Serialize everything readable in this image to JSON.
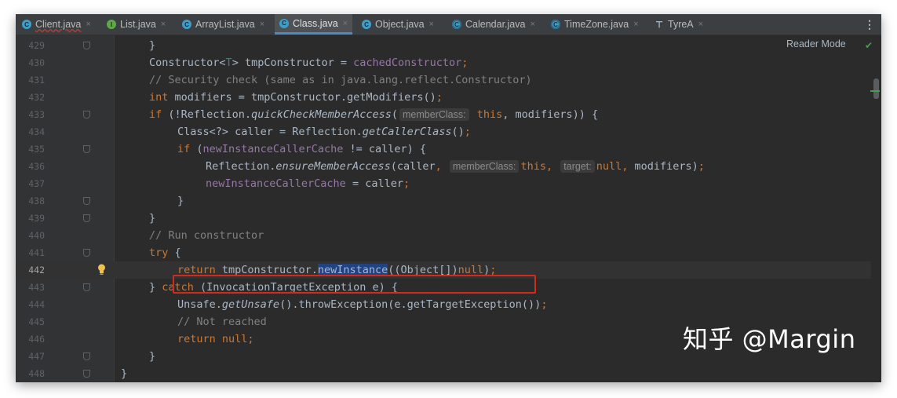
{
  "tabs": [
    {
      "label": "Client.java",
      "icon": "class-icon",
      "active": false
    },
    {
      "label": "List.java",
      "icon": "interface-icon",
      "active": false
    },
    {
      "label": "ArrayList.java",
      "icon": "class-icon",
      "active": false
    },
    {
      "label": "Class.java",
      "icon": "class-icon",
      "active": true
    },
    {
      "label": "Object.java",
      "icon": "class-icon",
      "active": false
    },
    {
      "label": "Calendar.java",
      "icon": "abstract-class-icon",
      "active": false
    },
    {
      "label": "TimeZone.java",
      "icon": "abstract-class-icon",
      "active": false
    },
    {
      "label": "TyreA",
      "icon": "structure-icon",
      "active": false
    }
  ],
  "tab_close_glyph": "×",
  "tab_more_glyph": "⋮",
  "editor": {
    "reader_mode_label": "Reader Mode",
    "current_line": 442,
    "selected_token": "newInstance",
    "colors": {
      "keyword": "#cc7832",
      "field": "#9876aa",
      "comment": "#808080",
      "highlight_box": "#d42a1c",
      "selection": "#214283"
    },
    "lines": [
      {
        "num": "429",
        "text": "}"
      },
      {
        "num": "430",
        "text": "Constructor<T> tmpConstructor = cachedConstructor;"
      },
      {
        "num": "431",
        "text": "// Security check (same as in java.lang.reflect.Constructor)"
      },
      {
        "num": "432",
        "text": "int modifiers = tmpConstructor.getModifiers();"
      },
      {
        "num": "433",
        "text": "if (!Reflection.quickCheckMemberAccess( memberClass: this, modifiers)) {"
      },
      {
        "num": "434",
        "text": "Class<?> caller = Reflection.getCallerClass();"
      },
      {
        "num": "435",
        "text": "if (newInstanceCallerCache != caller) {"
      },
      {
        "num": "436",
        "text": "Reflection.ensureMemberAccess(caller, memberClass: this, target: null, modifiers);"
      },
      {
        "num": "437",
        "text": "newInstanceCallerCache = caller;"
      },
      {
        "num": "438",
        "text": "}"
      },
      {
        "num": "439",
        "text": "}"
      },
      {
        "num": "440",
        "text": "// Run constructor"
      },
      {
        "num": "441",
        "text": "try {"
      },
      {
        "num": "442",
        "text": "return tmpConstructor.newInstance((Object[])null);"
      },
      {
        "num": "443",
        "text": "} catch (InvocationTargetException e) {"
      },
      {
        "num": "444",
        "text": "Unsafe.getUnsafe().throwException(e.getTargetException());"
      },
      {
        "num": "445",
        "text": "// Not reached"
      },
      {
        "num": "446",
        "text": "return null;"
      },
      {
        "num": "447",
        "text": "}"
      },
      {
        "num": "448",
        "text": "}"
      }
    ],
    "tokens": {
      "l429": [
        "}"
      ],
      "l430": [
        "Constructor<",
        "T",
        "> tmpConstructor = ",
        "cachedConstructor",
        ";"
      ],
      "l431": [
        "// Security check (same as in java.lang.reflect.Constructor)"
      ],
      "l432": [
        "int",
        " modifiers = tmpConstructor.getModifiers()",
        ";"
      ],
      "l433": [
        "if",
        " (!Reflection.",
        "quickCheckMemberAccess",
        "(",
        "memberClass:",
        " this",
        ", modifiers)) {"
      ],
      "l434": [
        "Class<?> caller = Reflection.",
        "getCallerClass",
        "()",
        ";"
      ],
      "l435": [
        "if",
        " (",
        "newInstanceCallerCache",
        " != caller) {"
      ],
      "l436": [
        "Reflection.",
        "ensureMemberAccess",
        "(caller",
        ",",
        "memberClass:",
        "this",
        ",",
        "target:",
        "null",
        ",",
        " modifiers)",
        ";"
      ],
      "l437": [
        "newInstanceCallerCache",
        " = caller",
        ";"
      ],
      "l438": [
        "}"
      ],
      "l439": [
        "}"
      ],
      "l440": [
        "// Run constructor"
      ],
      "l441": [
        "try",
        " {"
      ],
      "l442": [
        "return",
        " tmpConstructor.",
        "newInstance",
        "((Object[])",
        "null",
        ")",
        ";"
      ],
      "l443": [
        "} ",
        "catch",
        " (InvocationTargetException e) {"
      ],
      "l444": [
        "Unsafe.",
        "getUnsafe",
        "().throwException(e.getTargetException())",
        ";"
      ],
      "l445": [
        "// Not reached"
      ],
      "l446": [
        "return",
        " null",
        ";"
      ],
      "l447": [
        "}"
      ],
      "l448": [
        "}"
      ]
    }
  },
  "watermark": "知乎 @Margin"
}
